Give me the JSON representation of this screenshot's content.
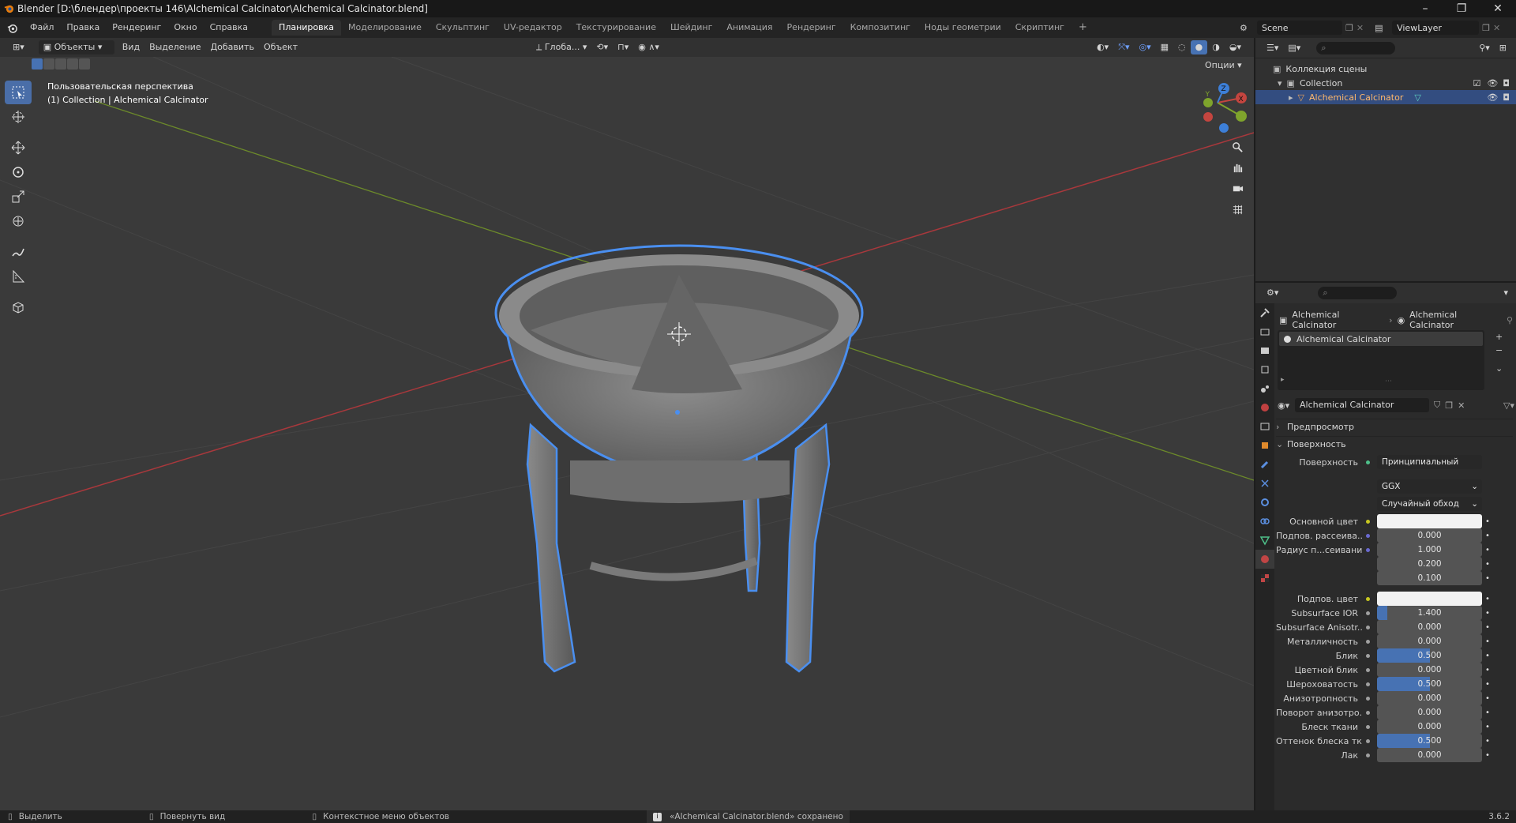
{
  "window": {
    "title": "Blender [D:\\блендер\\проекты 146\\Alchemical Calcinator\\Alchemical Calcinator.blend]",
    "controls": [
      "–",
      "❐",
      "✕"
    ]
  },
  "menu": {
    "items": [
      "Файл",
      "Правка",
      "Рендеринг",
      "Окно",
      "Справка"
    ],
    "workspaces": [
      "Планировка",
      "Моделирование",
      "Скульптинг",
      "UV-редактор",
      "Текстурирование",
      "Шейдинг",
      "Анимация",
      "Рендеринг",
      "Композитинг",
      "Ноды геометрии",
      "Скриптинг"
    ],
    "active_workspace": "Планировка",
    "add_tab": "+",
    "scene": "Scene",
    "view_layer": "ViewLayer"
  },
  "viewport": {
    "mode": "Объекты",
    "menus": [
      "Вид",
      "Выделение",
      "Добавить",
      "Объект"
    ],
    "transform_orientation": "Глоба...",
    "options": "Опции",
    "overlay_line1": "Пользовательская перспектива",
    "overlay_line2": "(1) Collection | Alchemical Calcinator",
    "gizmo": {
      "x": "X",
      "y": "Y",
      "z": "Z"
    },
    "tools": [
      "select-box-icon",
      "cursor-icon",
      "move-icon",
      "rotate-icon",
      "scale-icon",
      "transform-icon",
      "annotate-icon",
      "measure-icon",
      "add-cube-icon"
    ],
    "nav": [
      "zoom-icon",
      "hand-icon",
      "camera-icon",
      "grid-icon"
    ]
  },
  "outliner": {
    "rows": [
      {
        "label": "Коллекция сцены",
        "indent": 0
      },
      {
        "label": "Collection",
        "indent": 1
      },
      {
        "label": "Alchemical Calcinator",
        "indent": 2
      }
    ]
  },
  "properties": {
    "breadcrumb": [
      "Alchemical Calcinator",
      "Alchemical Calcinator"
    ],
    "material_slot": "Alchemical Calcinator",
    "material_name": "Alchemical Calcinator",
    "panels": {
      "preview": "Предпросмотр",
      "surface": "Поверхность"
    },
    "surface_label": "Поверхность",
    "surface_value": "Принципиальный BSDF",
    "distribution": "GGX",
    "subsurface_method": "Случайный обход",
    "params": [
      {
        "label": "Основной цвет",
        "kind": "color",
        "color": "#f2f2f2",
        "dot": "#c8c820"
      },
      {
        "label": "Подпов. рассеива...",
        "value": "0.000",
        "fill": 0,
        "dot": "#6a6ad0"
      },
      {
        "label": "Радиус п...сеивания",
        "value": "1.000",
        "fill": 0,
        "dot": "#6a6ad0"
      },
      {
        "label": "",
        "value": "0.200",
        "fill": 0,
        "dot": ""
      },
      {
        "label": "",
        "value": "0.100",
        "fill": 0,
        "dot": ""
      },
      {
        "label": "Подпов. цвет",
        "kind": "color",
        "color": "#f2f2f2",
        "dot": "#c8c820"
      },
      {
        "label": "Subsurface IOR",
        "value": "1.400",
        "fill": 0.1,
        "dot": "#a0a0a0"
      },
      {
        "label": "Subsurface Anisotr...",
        "value": "0.000",
        "fill": 0,
        "dot": "#a0a0a0"
      },
      {
        "label": "Металличность",
        "value": "0.000",
        "fill": 0,
        "dot": "#a0a0a0"
      },
      {
        "label": "Блик",
        "value": "0.500",
        "fill": 0.5,
        "dot": "#a0a0a0"
      },
      {
        "label": "Цветной блик",
        "value": "0.000",
        "fill": 0,
        "dot": "#a0a0a0"
      },
      {
        "label": "Шероховатость",
        "value": "0.500",
        "fill": 0.5,
        "dot": "#a0a0a0"
      },
      {
        "label": "Анизотропность",
        "value": "0.000",
        "fill": 0,
        "dot": "#a0a0a0"
      },
      {
        "label": "Поворот анизотро...",
        "value": "0.000",
        "fill": 0,
        "dot": "#a0a0a0"
      },
      {
        "label": "Блеск ткани",
        "value": "0.000",
        "fill": 0,
        "dot": "#a0a0a0"
      },
      {
        "label": "Оттенок блеска тк...",
        "value": "0.500",
        "fill": 0.5,
        "dot": "#a0a0a0"
      },
      {
        "label": "Лак",
        "value": "0.000",
        "fill": 0,
        "dot": "#a0a0a0"
      }
    ]
  },
  "status": {
    "select": "Выделить",
    "rotate": "Повернуть вид",
    "context": "Контекстное меню объектов",
    "message": "«Alchemical Calcinator.blend» сохранено",
    "version": "3.6.2"
  }
}
